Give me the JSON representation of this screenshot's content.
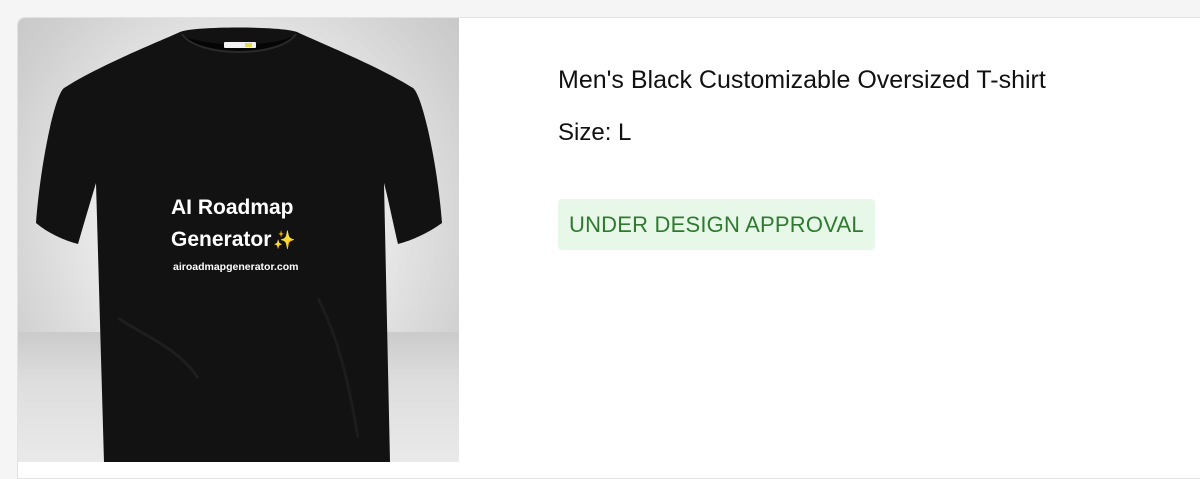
{
  "product": {
    "image_alt": "Men's black oversized t-shirt mockup",
    "print": {
      "line1": "AI Roadmap",
      "line2": "Generator",
      "sparkle": "✨",
      "url": "airoadmapgenerator.com"
    },
    "title": "Men's Black Customizable Oversized T-shirt",
    "size_text": "Size: L",
    "status": "UNDER DESIGN APPROVAL"
  },
  "colors": {
    "status_text": "#2f7a30",
    "status_bg": "#e8f8e8",
    "shirt": "#121212"
  }
}
